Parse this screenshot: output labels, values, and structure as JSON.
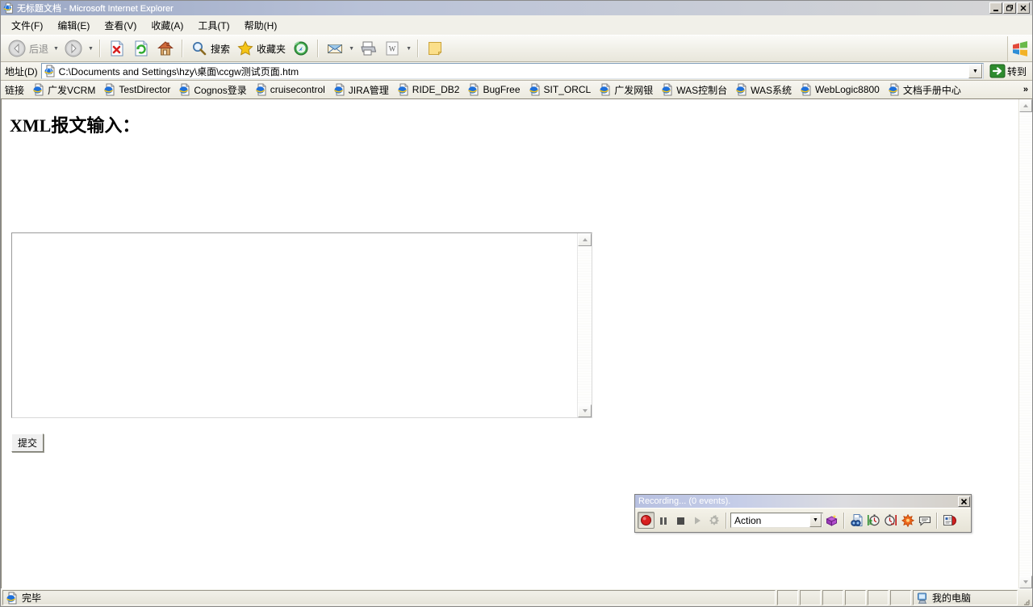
{
  "window": {
    "title": "无标题文档 - Microsoft Internet Explorer",
    "icon": "ie-page-icon",
    "minimize_label": "_",
    "restore_label": "❐",
    "close_label": "✕"
  },
  "menubar": {
    "items": [
      {
        "label": "文件(F)",
        "name": "menu-file"
      },
      {
        "label": "编辑(E)",
        "name": "menu-edit"
      },
      {
        "label": "查看(V)",
        "name": "menu-view"
      },
      {
        "label": "收藏(A)",
        "name": "menu-favorites"
      },
      {
        "label": "工具(T)",
        "name": "menu-tools"
      },
      {
        "label": "帮助(H)",
        "name": "menu-help"
      }
    ]
  },
  "toolbar": {
    "back_label": "后退",
    "search_label": "搜索",
    "favorites_label": "收藏夹",
    "buttons": [
      {
        "name": "back-button",
        "icon": "back-arrow-icon"
      },
      {
        "name": "forward-button",
        "icon": "forward-arrow-icon"
      },
      {
        "name": "stop-button",
        "icon": "stop-icon"
      },
      {
        "name": "refresh-button",
        "icon": "refresh-icon"
      },
      {
        "name": "home-button",
        "icon": "home-icon"
      },
      {
        "name": "search-button",
        "icon": "search-icon"
      },
      {
        "name": "favorites-button",
        "icon": "star-icon"
      },
      {
        "name": "history-button",
        "icon": "history-icon"
      },
      {
        "name": "mail-button",
        "icon": "mail-icon"
      },
      {
        "name": "print-button",
        "icon": "printer-icon"
      },
      {
        "name": "edit-button",
        "icon": "word-edit-icon"
      },
      {
        "name": "notes-button",
        "icon": "yellow-note-icon"
      }
    ],
    "brand_icon": "windows-flag-icon"
  },
  "addressbar": {
    "label": "地址(D)",
    "value": "C:\\Documents and Settings\\hzy\\桌面\\ccgw测试页面.htm",
    "placeholder": "",
    "favicon": "ie-page-icon",
    "dropdown_glyph": "▼",
    "go_label": "转到",
    "go_icon": "green-arrow-icon"
  },
  "linksbar": {
    "label": "链接",
    "items": [
      {
        "label": "广发VCRM"
      },
      {
        "label": "TestDirector"
      },
      {
        "label": "Cognos登录"
      },
      {
        "label": "cruisecontrol"
      },
      {
        "label": "JIRA管理"
      },
      {
        "label": "RIDE_DB2"
      },
      {
        "label": "BugFree"
      },
      {
        "label": "SIT_ORCL"
      },
      {
        "label": "广发网银"
      },
      {
        "label": "WAS控制台"
      },
      {
        "label": "WAS系统"
      },
      {
        "label": "WebLogic8800"
      },
      {
        "label": "文档手册中心"
      }
    ],
    "overflow_glyph": "»"
  },
  "page": {
    "heading": "XML报文输入：",
    "textarea_value": "",
    "textarea_placeholder": "",
    "submit_label": "提交"
  },
  "recorder": {
    "title": "Recording... (0 events).",
    "close_label": "✕",
    "buttons": [
      {
        "name": "record-button",
        "icon": "record-circle-icon",
        "state": "pressed"
      },
      {
        "name": "pause-button",
        "icon": "pause-bars-icon",
        "state": "normal"
      },
      {
        "name": "stop-button",
        "icon": "stop-square-icon",
        "state": "normal"
      },
      {
        "name": "run-button",
        "icon": "play-triangle-icon",
        "state": "disabled"
      },
      {
        "name": "settings-button",
        "icon": "gear-icon",
        "state": "disabled"
      }
    ],
    "action_select": {
      "value": "Action",
      "arrow_glyph": "▼"
    },
    "tool_buttons": [
      {
        "name": "insert-action-button",
        "icon": "purple-box-icon"
      },
      {
        "name": "checkpoint-button",
        "icon": "checkpoint-binoculars-icon"
      },
      {
        "name": "start-transaction-button",
        "icon": "stopwatch-start-icon"
      },
      {
        "name": "end-transaction-button",
        "icon": "stopwatch-end-icon"
      },
      {
        "name": "insert-step-button",
        "icon": "orange-star-icon"
      },
      {
        "name": "comment-button",
        "icon": "speech-bubble-icon"
      },
      {
        "name": "active-screen-button",
        "icon": "report-icon"
      }
    ]
  },
  "statusbar": {
    "status_text": "完毕",
    "status_icon": "ie-page-icon",
    "zone_text": "我的电脑",
    "zone_icon": "my-computer-icon",
    "panes": [
      "",
      "",
      "",
      "",
      "",
      ""
    ]
  },
  "colors": {
    "titlebar_start": "#9aa7c4",
    "toolbar_bg": "#f2f1ea",
    "chrome_bg": "#d4d0c8",
    "page_bg": "#ffffff",
    "go_green": "#2e8b2e",
    "record_red": "#d81f1f"
  }
}
